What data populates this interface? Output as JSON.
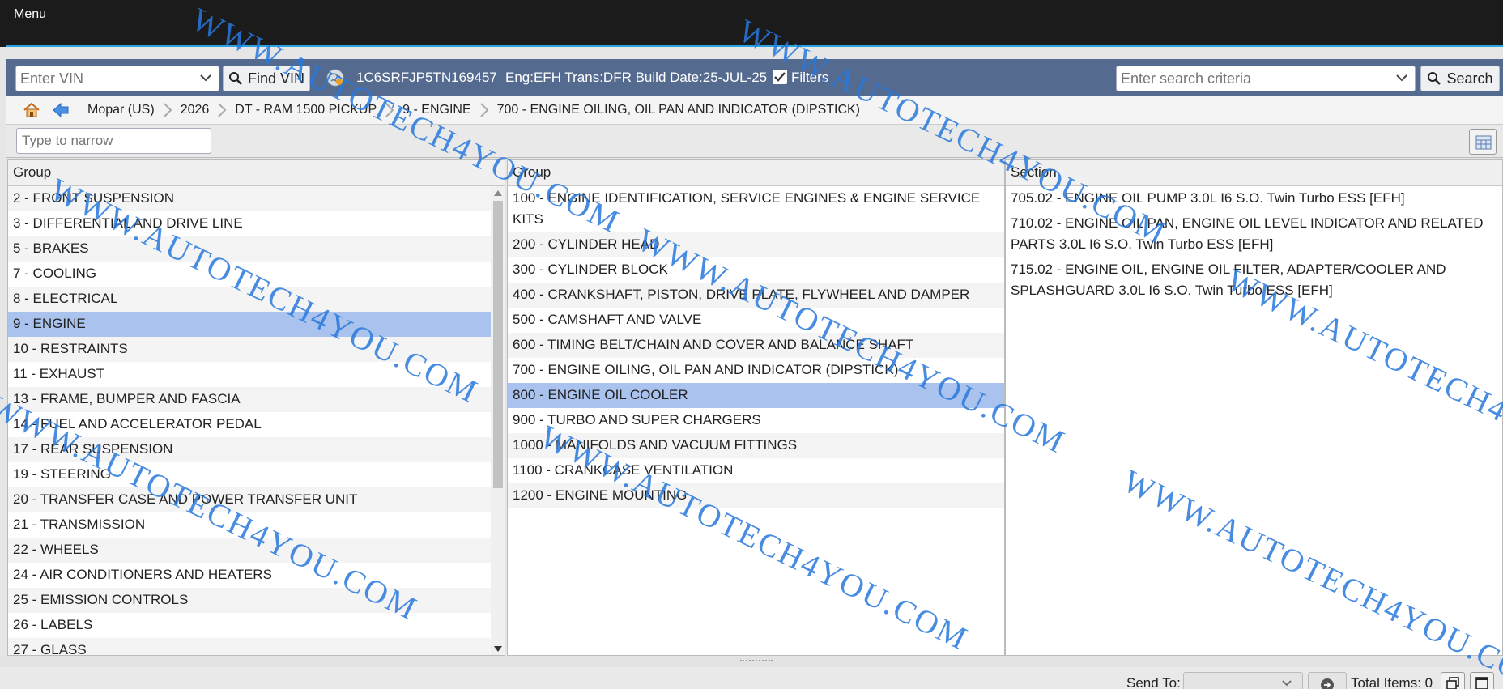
{
  "topbar": {
    "menu_label": "Menu"
  },
  "toolbar": {
    "vin_placeholder": "Enter VIN",
    "find_vin_label": "Find VIN",
    "vin_number": "1C6SRFJP5TN169457",
    "vin_info": "Eng:EFH Trans:DFR Build Date:25-JUL-25",
    "filters_label": "Filters",
    "filters_checked": true,
    "search_placeholder": "Enter search criteria",
    "search_label": "Search"
  },
  "breadcrumb": {
    "items": [
      "Mopar (US)",
      "2026",
      "DT - RAM 1500 PICKUP",
      "9 - ENGINE",
      "700 - ENGINE OILING, OIL PAN AND INDICATOR (DIPSTICK)"
    ]
  },
  "narrow": {
    "placeholder": "Type to narrow"
  },
  "panels": {
    "group1": {
      "header": "Group",
      "selected_index": 5,
      "rows": [
        "2 - FRONT SUSPENSION",
        "3 - DIFFERENTIAL AND DRIVE LINE",
        "5 - BRAKES",
        "7 - COOLING",
        "8 - ELECTRICAL",
        "9 - ENGINE",
        "10 - RESTRAINTS",
        "11 - EXHAUST",
        "13 - FRAME, BUMPER AND FASCIA",
        "14 - FUEL AND ACCELERATOR PEDAL",
        "17 - REAR SUSPENSION",
        "19 - STEERING",
        "20 - TRANSFER CASE AND POWER TRANSFER UNIT",
        "21 - TRANSMISSION",
        "22 - WHEELS",
        "24 - AIR CONDITIONERS AND HEATERS",
        "25 - EMISSION CONTROLS",
        "26 - LABELS",
        "27 - GLASS"
      ]
    },
    "group2": {
      "header": "Group",
      "selected_index": 7,
      "rows": [
        "100 - ENGINE IDENTIFICATION, SERVICE ENGINES & ENGINE SERVICE KITS",
        "200 - CYLINDER HEAD",
        "300 - CYLINDER BLOCK",
        "400 - CRANKSHAFT, PISTON, DRIVE PLATE, FLYWHEEL AND DAMPER",
        "500 - CAMSHAFT AND VALVE",
        "600 - TIMING BELT/CHAIN AND COVER AND BALANCE SHAFT",
        "700 - ENGINE OILING, OIL PAN AND INDICATOR (DIPSTICK)",
        "800 - ENGINE OIL COOLER",
        "900 - TURBO AND SUPER CHARGERS",
        "1000 - MANIFOLDS AND VACUUM FITTINGS",
        "1100 - CRANKCASE VENTILATION",
        "1200 - ENGINE MOUNTING"
      ]
    },
    "section": {
      "header": "Section",
      "rows": [
        "705.02 - ENGINE OIL PUMP 3.0L I6 S.O. Twin Turbo ESS [EFH]",
        "710.02 - ENGINE OIL PAN, ENGINE OIL LEVEL INDICATOR AND RELATED PARTS 3.0L I6 S.O. Twin Turbo ESS [EFH]",
        "715.02 - ENGINE OIL, ENGINE OIL FILTER, ADAPTER/COOLER AND SPLASHGUARD 3.0L I6 S.O. Twin Turbo ESS [EFH]"
      ]
    }
  },
  "footer": {
    "send_to_label": "Send To:",
    "send_to_value": "",
    "total_items_label": "Total Items: 0"
  },
  "watermark": {
    "text": "WWW.AUTOTECH4YOU.COM"
  },
  "colors": {
    "accent": "#2ba3e0",
    "toolbar": "#546a8f",
    "selected_row": "#a9c3ee",
    "watermark": "#2878dc"
  }
}
